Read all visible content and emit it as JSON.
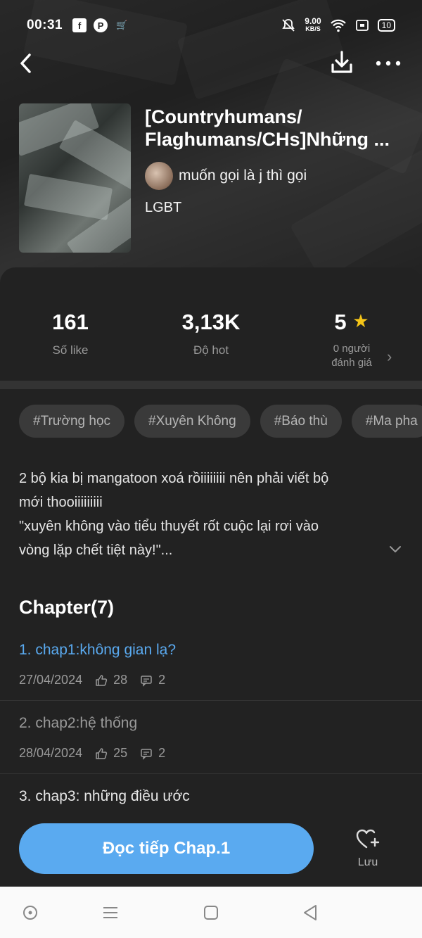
{
  "status_bar": {
    "time": "00:31",
    "net_speed_value": "9.00",
    "net_speed_unit": "KB/S",
    "battery": "10"
  },
  "book": {
    "title_line1": "[Countryhumans/",
    "title_line2": "Flaghumans/CHs]Những ...",
    "author": "muốn gọi là j thì gọi",
    "genre": "LGBT"
  },
  "stats": {
    "likes": {
      "value": "161",
      "label": "Số like"
    },
    "hot": {
      "value": "3,13K",
      "label": "Độ hot"
    },
    "rating": {
      "value": "5",
      "label_line1": "0 người",
      "label_line2": "đánh giá"
    }
  },
  "tags": [
    "#Trường học",
    "#Xuyên Không",
    "#Báo thù",
    "#Ma pha"
  ],
  "description": {
    "line1": "2 bộ kia bị mangatoon xoá rồiiiiiiii nên phải viết bộ",
    "line2": "mới thooiiiiiiiii",
    "line3": "\"xuyên không vào tiểu thuyết rốt cuộc lại rơi vào",
    "line4": "vòng lặp chết tiệt này!\"..."
  },
  "chapters_header": "Chapter(7)",
  "chapters": [
    {
      "name": "1. chap1:không gian lạ?",
      "date": "27/04/2024",
      "likes": "28",
      "comments": "2",
      "active": true
    },
    {
      "name": "2. chap2:hệ thống",
      "date": "28/04/2024",
      "likes": "25",
      "comments": "2",
      "active": false
    },
    {
      "name": "3. chap3: những điều ước",
      "date": "",
      "likes": "",
      "comments": "",
      "active": false
    }
  ],
  "actions": {
    "read_button": "Đọc tiếp Chap.1",
    "save_label": "Lưu"
  },
  "colors": {
    "accent": "#5aaaf0",
    "active_chapter": "#5aaaf0",
    "star": "#f5c518"
  }
}
